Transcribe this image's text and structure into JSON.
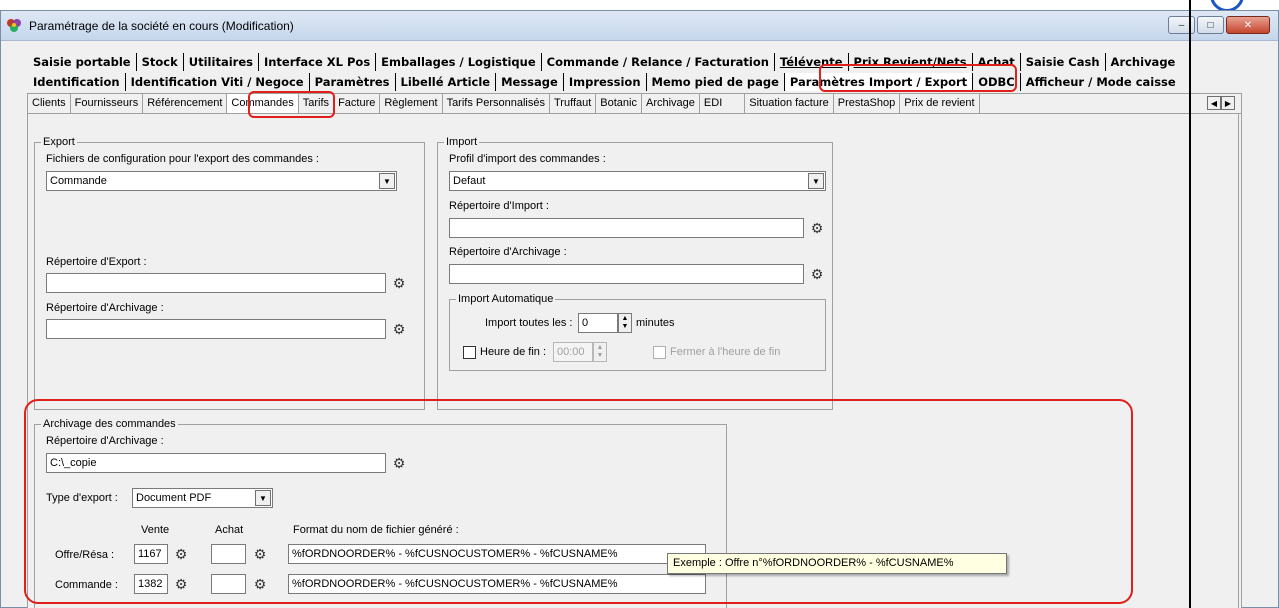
{
  "window": {
    "title": "Paramétrage de la société en cours (Modification)",
    "buttons": {
      "minimize": "–",
      "maximize": "□",
      "close": "✕"
    }
  },
  "main_tabs_row1": [
    "Saisie portable",
    "Stock",
    "Utilitaires",
    "Interface XL Pos",
    "Emballages / Logistique",
    "Commande / Relance / Facturation",
    "Télévente",
    "Prix Revient/Nets",
    "Achat",
    "Saisie Cash",
    "Archivage"
  ],
  "main_tabs_row2": [
    "Identification",
    "Identification Viti / Negoce",
    "Paramètres",
    "Libellé Article",
    "Message",
    "Impression",
    "Memo pied de page",
    "Paramètres Import / Export",
    "ODBC",
    "Afficheur / Mode caisse"
  ],
  "sub_tabs": [
    "Clients",
    "Fournisseurs",
    "Référencement",
    "Commandes",
    "Tarifs",
    "Facture",
    "Règlement",
    "Tarifs Personnalisés",
    "Truffaut",
    "Botanic",
    "Archivage",
    "EDI",
    "Situation facture",
    "PrestaShop",
    "Prix de revient"
  ],
  "export": {
    "legend": "Export",
    "config_label": "Fichiers de configuration pour l'export des commandes :",
    "config_value": "Commande",
    "export_dir_label": "Répertoire d'Export :",
    "export_dir_value": "",
    "archive_dir_label": "Répertoire d'Archivage :",
    "archive_dir_value": ""
  },
  "import": {
    "legend": "Import",
    "profile_label": "Profil d'import des commandes :",
    "profile_value": "Defaut",
    "import_dir_label": "Répertoire d'Import :",
    "import_dir_value": "",
    "archive_dir_label": "Répertoire d'Archivage :",
    "archive_dir_value": "",
    "auto": {
      "legend": "Import Automatique",
      "every_label": "Import toutes les :",
      "every_value": "0",
      "minutes_label": "minutes",
      "end_time_label": "Heure de fin :",
      "end_time_value": "00:00",
      "close_label": "Fermer à l'heure de fin"
    }
  },
  "archivage": {
    "legend": "Archivage des commandes",
    "dir_label": "Répertoire d'Archivage :",
    "dir_value": "C:\\_copie",
    "type_label": "Type d'export :",
    "type_value": "Document PDF",
    "col_vente": "Vente",
    "col_achat": "Achat",
    "col_format": "Format du nom de fichier généré :",
    "offre_label": "Offre/Résa :",
    "offre_vente": "1167",
    "offre_achat": "",
    "offre_format": "%fORDNOORDER% - %fCUSNOCUSTOMER% - %fCUSNAME%",
    "commande_label": "Commande :",
    "commande_vente": "1382",
    "commande_achat": "",
    "commande_format": "%fORDNOORDER% - %fCUSNOCUSTOMER% - %fCUSNAME%"
  },
  "tooltip": "Exemple : Offre n°%fORDNOORDER% - %fCUSNAME%",
  "icons": {
    "picker": "folder-picker-icon",
    "combo": "chevron-down-icon",
    "spin": "spin-updown-icon"
  },
  "colors": {
    "highlight": "#e0201a",
    "window_bg": "#f0f0f0"
  }
}
